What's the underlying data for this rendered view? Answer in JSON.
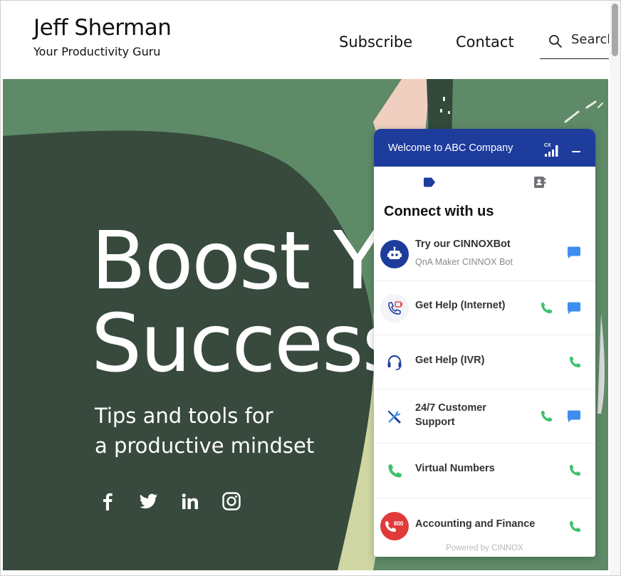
{
  "site": {
    "title": "Jeff Sherman",
    "tagline": "Your Productivity Guru"
  },
  "nav": {
    "subscribe": "Subscribe",
    "contact": "Contact",
    "search_label": "Search"
  },
  "hero": {
    "heading_line1": "Boost Y",
    "heading_line2": "Success",
    "sub_line1": "Tips and tools for",
    "sub_line2": "a productive mindset",
    "social_icons": [
      "facebook-icon",
      "twitter-icon",
      "linkedin-icon",
      "instagram-icon"
    ]
  },
  "widget": {
    "title": "Welcome to ABC Company",
    "signal_badge": "CX",
    "heading": "Connect with us",
    "powered_by": "Powered by CINNOX",
    "accent_color": "#1d3c9c",
    "items": [
      {
        "title": "Try our CINNOXBot",
        "subtitle": "QnA Maker CINNOX Bot",
        "icon": "bot-icon",
        "actions": [
          "chat"
        ]
      },
      {
        "title": "Get Help (Internet)",
        "icon": "web-call-icon",
        "actions": [
          "phone",
          "chat"
        ]
      },
      {
        "title": "Get Help (IVR)",
        "icon": "headset-icon",
        "actions": [
          "phone"
        ]
      },
      {
        "title_line1": "24/7 Customer",
        "title_line2": "Support",
        "icon": "tools-icon",
        "actions": [
          "phone",
          "chat"
        ]
      },
      {
        "title": "Virtual Numbers",
        "icon": "phone-icon",
        "actions": [
          "phone"
        ]
      },
      {
        "title": "Accounting and Finance",
        "icon": "toll-free-800-icon",
        "badge": "800",
        "actions": [
          "phone"
        ]
      }
    ]
  }
}
